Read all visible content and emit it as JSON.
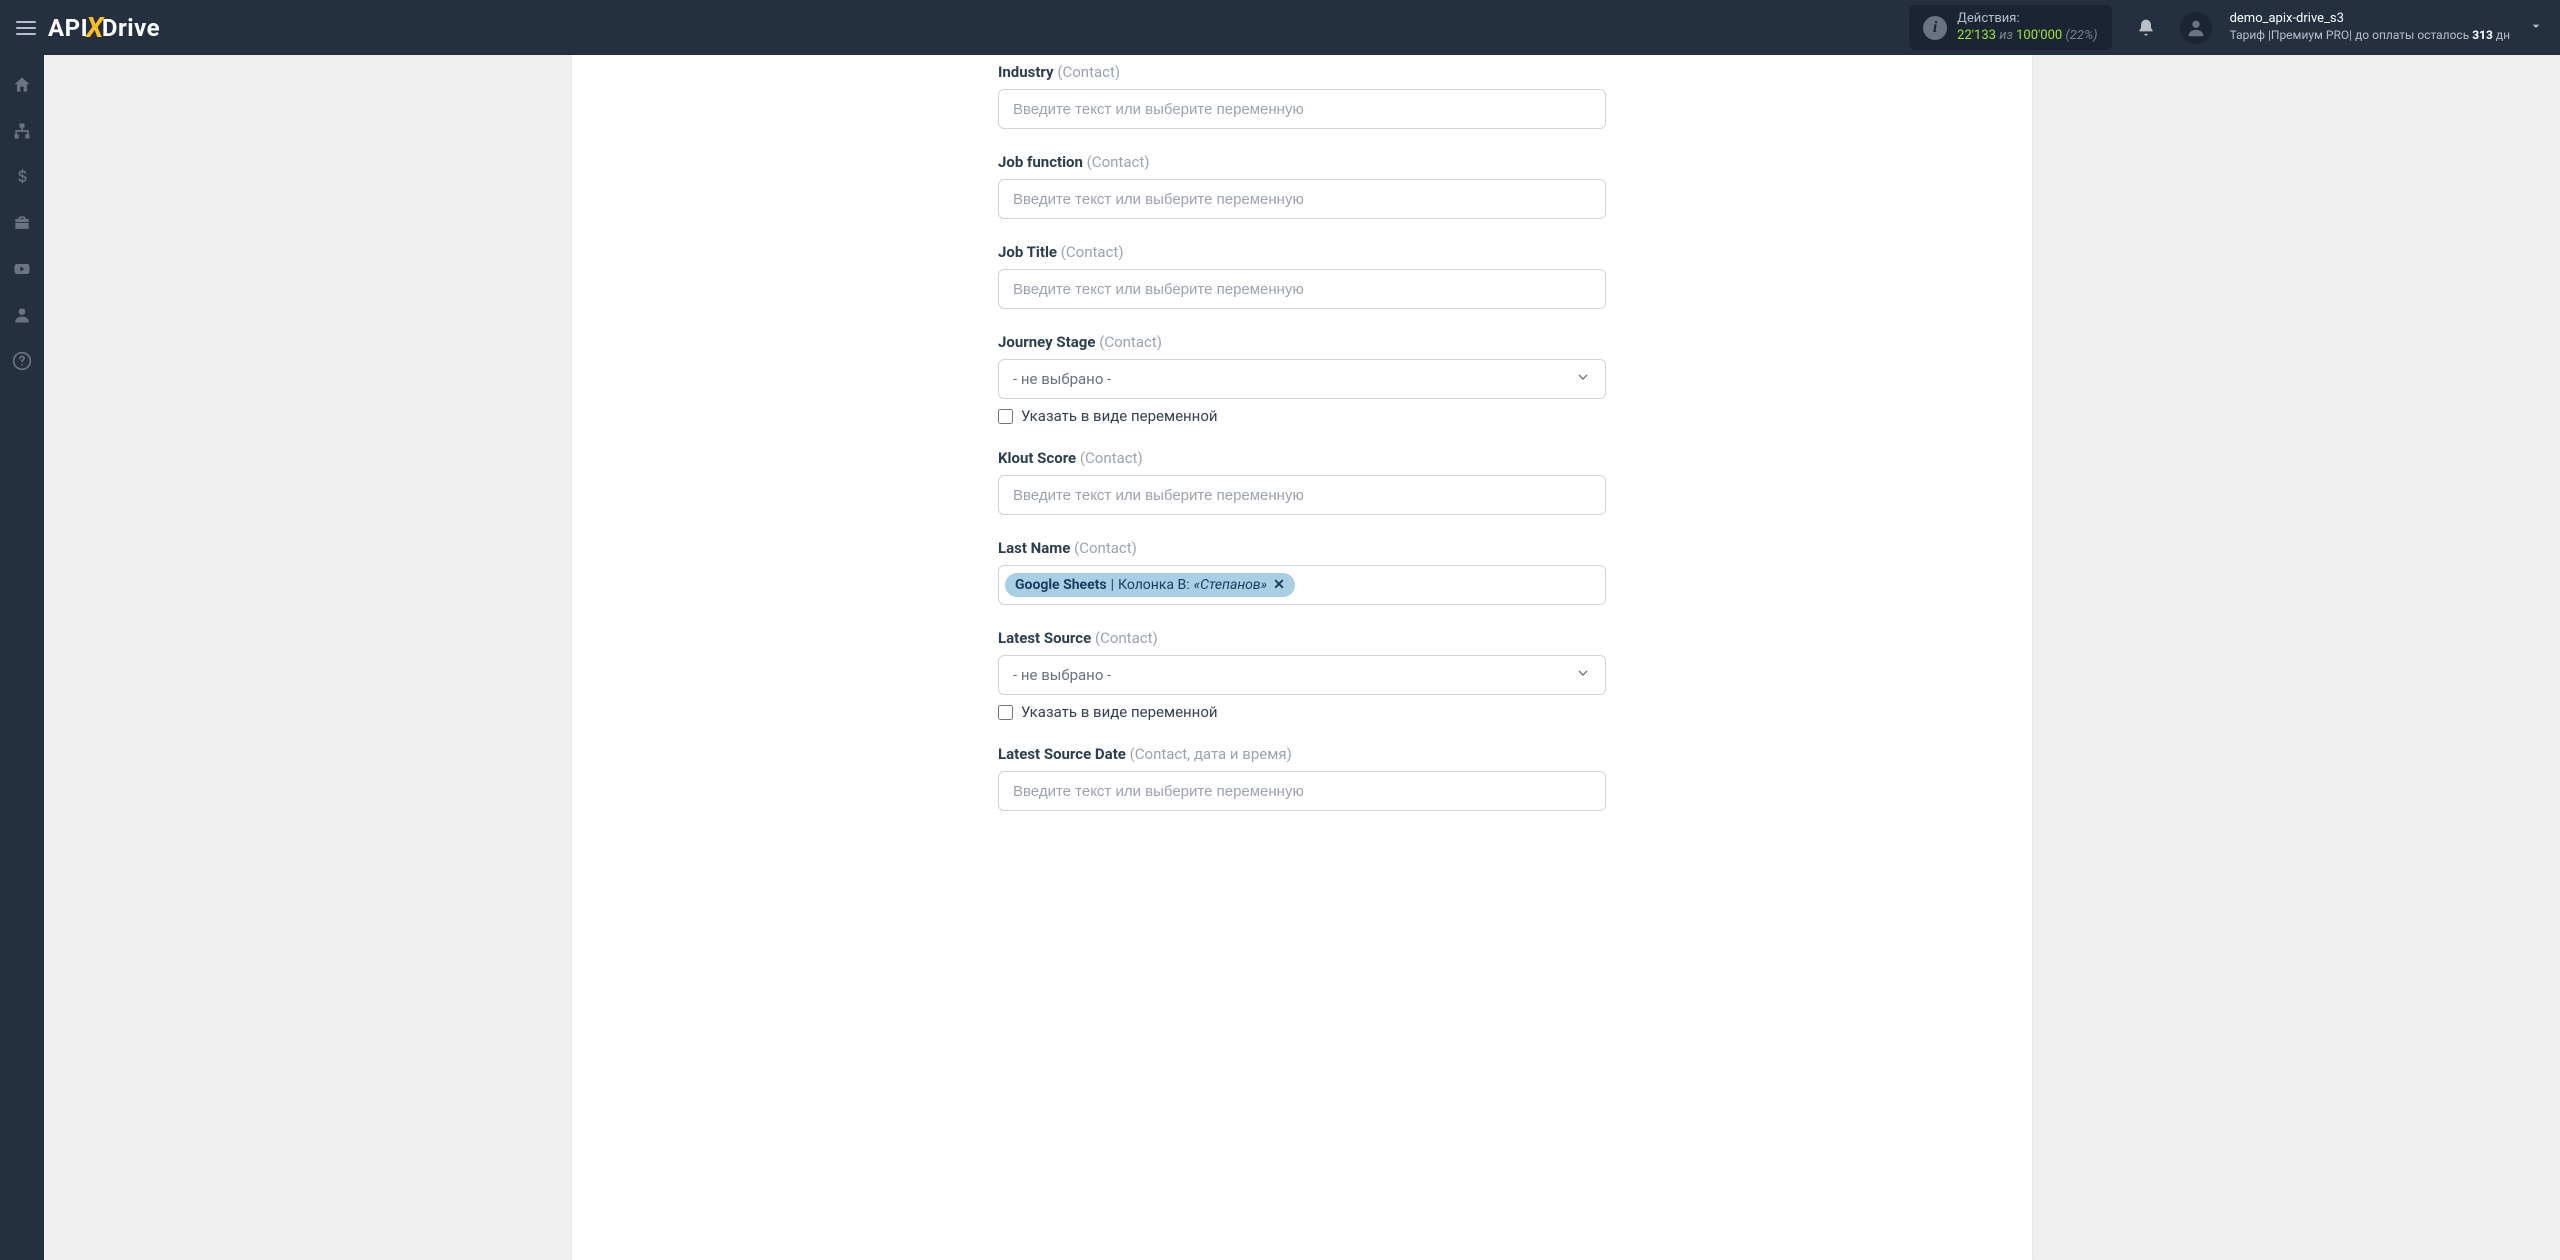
{
  "logo": {
    "part1": "API",
    "x": "X",
    "part2": "Drive"
  },
  "header": {
    "actions_label": "Действия:",
    "actions_current": "22'133",
    "actions_of": "из",
    "actions_total": "100'000",
    "actions_pct": "(22%)",
    "username": "demo_apix-drive_s3",
    "plan_prefix": "Тариф |Премиум PRO|  до оплаты осталось ",
    "plan_days": "313",
    "plan_suffix": " дн"
  },
  "fields": {
    "placeholder_text": "Введите текст или выберите переменную",
    "select_placeholder": "- не выбрано -",
    "checkbox_label": "Указать в виде переменной",
    "industry": {
      "label": "Industry",
      "hint": "(Contact)"
    },
    "job_function": {
      "label": "Job function",
      "hint": "(Contact)"
    },
    "job_title": {
      "label": "Job Title",
      "hint": "(Contact)"
    },
    "journey_stage": {
      "label": "Journey Stage",
      "hint": "(Contact)"
    },
    "klout_score": {
      "label": "Klout Score",
      "hint": "(Contact)"
    },
    "last_name": {
      "label": "Last Name",
      "hint": "(Contact)",
      "chip_src": "Google Sheets",
      "chip_sep": " | ",
      "chip_col": "Колонка B: ",
      "chip_val": "«Степанов»"
    },
    "latest_source": {
      "label": "Latest Source",
      "hint": "(Contact)"
    },
    "latest_source_date": {
      "label": "Latest Source Date",
      "hint": "(Contact, дата и время)"
    }
  }
}
